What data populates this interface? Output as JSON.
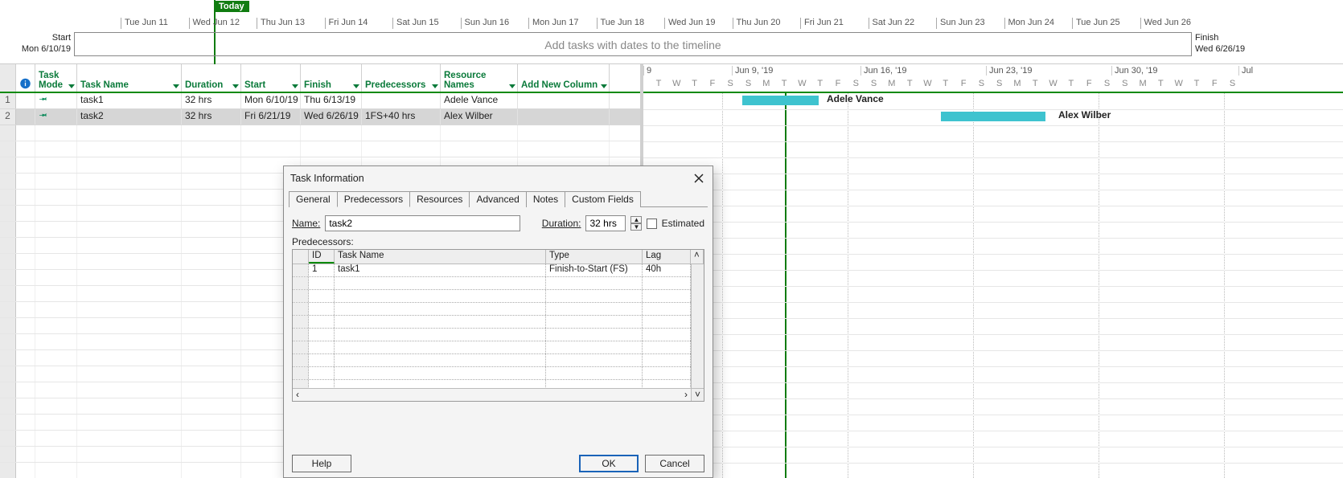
{
  "timeline": {
    "today_label": "Today",
    "ticks": [
      "Tue Jun 11",
      "Wed Jun 12",
      "Thu Jun 13",
      "Fri Jun 14",
      "Sat Jun 15",
      "Sun Jun 16",
      "Mon Jun 17",
      "Tue Jun 18",
      "Wed Jun 19",
      "Thu Jun 20",
      "Fri Jun 21",
      "Sat Jun 22",
      "Sun Jun 23",
      "Mon Jun 24",
      "Tue Jun 25",
      "Wed Jun 26"
    ],
    "placeholder": "Add tasks with dates to the timeline",
    "start_label": "Start",
    "start_date": "Mon 6/10/19",
    "finish_label": "Finish",
    "finish_date": "Wed 6/26/19"
  },
  "grid": {
    "headers": {
      "task_mode": "Task Mode",
      "task_name": "Task Name",
      "duration": "Duration",
      "start": "Start",
      "finish": "Finish",
      "predecessors": "Predecessors",
      "resource_names": "Resource Names",
      "add_new": "Add New Column"
    },
    "rows": [
      {
        "num": "1",
        "name": "task1",
        "duration": "32 hrs",
        "start": "Mon 6/10/19",
        "finish": "Thu 6/13/19",
        "pred": "",
        "res": "Adele Vance"
      },
      {
        "num": "2",
        "name": "task2",
        "duration": "32 hrs",
        "start": "Fri 6/21/19",
        "finish": "Wed 6/26/19",
        "pred": "1FS+40 hrs",
        "res": "Alex Wilber"
      }
    ]
  },
  "gantt": {
    "weeks": [
      "9",
      "Jun 9, '19",
      "Jun 16, '19",
      "Jun 23, '19",
      "Jun 30, '19",
      "Jul"
    ],
    "day_letters": [
      "T",
      "W",
      "T",
      "F",
      "S",
      "S",
      "M",
      "T",
      "W",
      "T",
      "F",
      "S",
      "S",
      "M",
      "T",
      "W",
      "T",
      "F",
      "S",
      "S",
      "M",
      "T",
      "W",
      "T",
      "F",
      "S",
      "S",
      "M",
      "T",
      "W",
      "T",
      "F",
      "S"
    ],
    "bars": [
      {
        "label": "Adele Vance"
      },
      {
        "label": "Alex Wilber"
      }
    ]
  },
  "dialog": {
    "title": "Task Information",
    "tabs": [
      "General",
      "Predecessors",
      "Resources",
      "Advanced",
      "Notes",
      "Custom Fields"
    ],
    "active_tab": "Predecessors",
    "name_label": "Name:",
    "name_value": "task2",
    "duration_label": "Duration:",
    "duration_value": "32 hrs",
    "estimated_label": "Estimated",
    "pred_section": "Predecessors:",
    "pred_headers": {
      "id": "ID",
      "task_name": "Task Name",
      "type": "Type",
      "lag": "Lag"
    },
    "pred_rows": [
      {
        "id": "1",
        "task_name": "task1",
        "type": "Finish-to-Start (FS)",
        "lag": "40h"
      }
    ],
    "help": "Help",
    "ok": "OK",
    "cancel": "Cancel"
  }
}
